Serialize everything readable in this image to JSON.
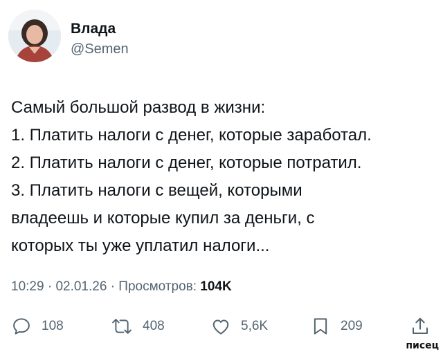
{
  "author": {
    "display_name": "Влада",
    "handle": "@Semen"
  },
  "tweet": {
    "lines": [
      "Самый большой развод в жизни:",
      "1. Платить налоги с денег, которые заработал.",
      "2. Платить налоги с денег, которые потратил.",
      "3. Платить налоги с вещей, которыми",
      "владеешь и которые купил за деньги, с",
      "которых ты уже уплатил налоги..."
    ]
  },
  "meta": {
    "time": "10:29",
    "separator": "·",
    "date": "02.01.26",
    "views_label": "Просмотров:",
    "views_count": "104K"
  },
  "actions": {
    "replies": "108",
    "reposts": "408",
    "likes": "5,6K",
    "bookmarks": "209"
  },
  "watermark": "писец",
  "colors": {
    "text": "#0f1419",
    "secondary": "#536471",
    "background": "#ffffff"
  },
  "icons": [
    "reply-icon",
    "repost-icon",
    "like-icon",
    "bookmark-icon",
    "share-icon"
  ]
}
